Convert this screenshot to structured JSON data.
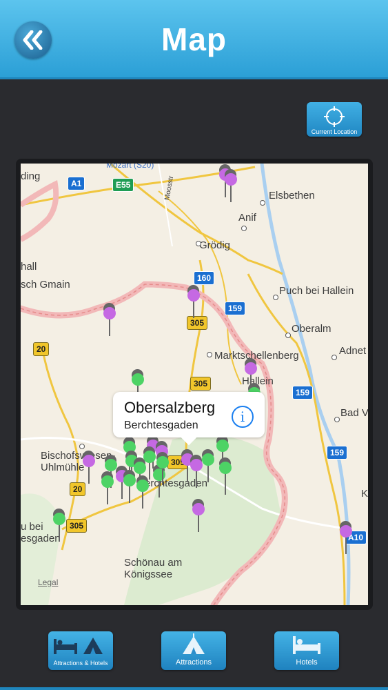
{
  "header": {
    "title": "Map",
    "back_icon": "double-chevron-left-icon"
  },
  "current_location": {
    "label": "Current Location",
    "icon": "crosshair-icon"
  },
  "map": {
    "places": [
      "Elsbethen",
      "Anif",
      "Grödig",
      "hall",
      "sch Gmain",
      "Puch bei Hallein",
      "Oberalm",
      "Adnet",
      "Marktschellenberg",
      "Hallein",
      "Bad V",
      "Bischofswiesen-",
      "Uhlmühle",
      "Berchtesgaden",
      "u bei",
      "esgaden",
      "Schönau am",
      "Königssee",
      "K",
      "ding",
      "Mozart (S20)",
      "Moosstr"
    ],
    "shields": [
      "A1",
      "E55",
      "160",
      "159",
      "305",
      "20",
      "305",
      "159",
      "159",
      "20",
      "305",
      "305",
      "A10"
    ],
    "legal": "Legal",
    "callout": {
      "title": "Obersalzberg",
      "subtitle": "Berchtesgaden",
      "info_icon": "info-icon"
    }
  },
  "bottom_bar": {
    "buttons": [
      {
        "label": "Attractions & Hotels",
        "icon": "bed-and-tent-icon"
      },
      {
        "label": "Attractions",
        "icon": "tent-icon"
      },
      {
        "label": "Hotels",
        "icon": "bed-icon"
      }
    ]
  },
  "colors": {
    "accent": "#2b9fd6",
    "background": "#2a2b2f",
    "pin_purple": "#c569e3",
    "pin_green": "#4dd365"
  }
}
